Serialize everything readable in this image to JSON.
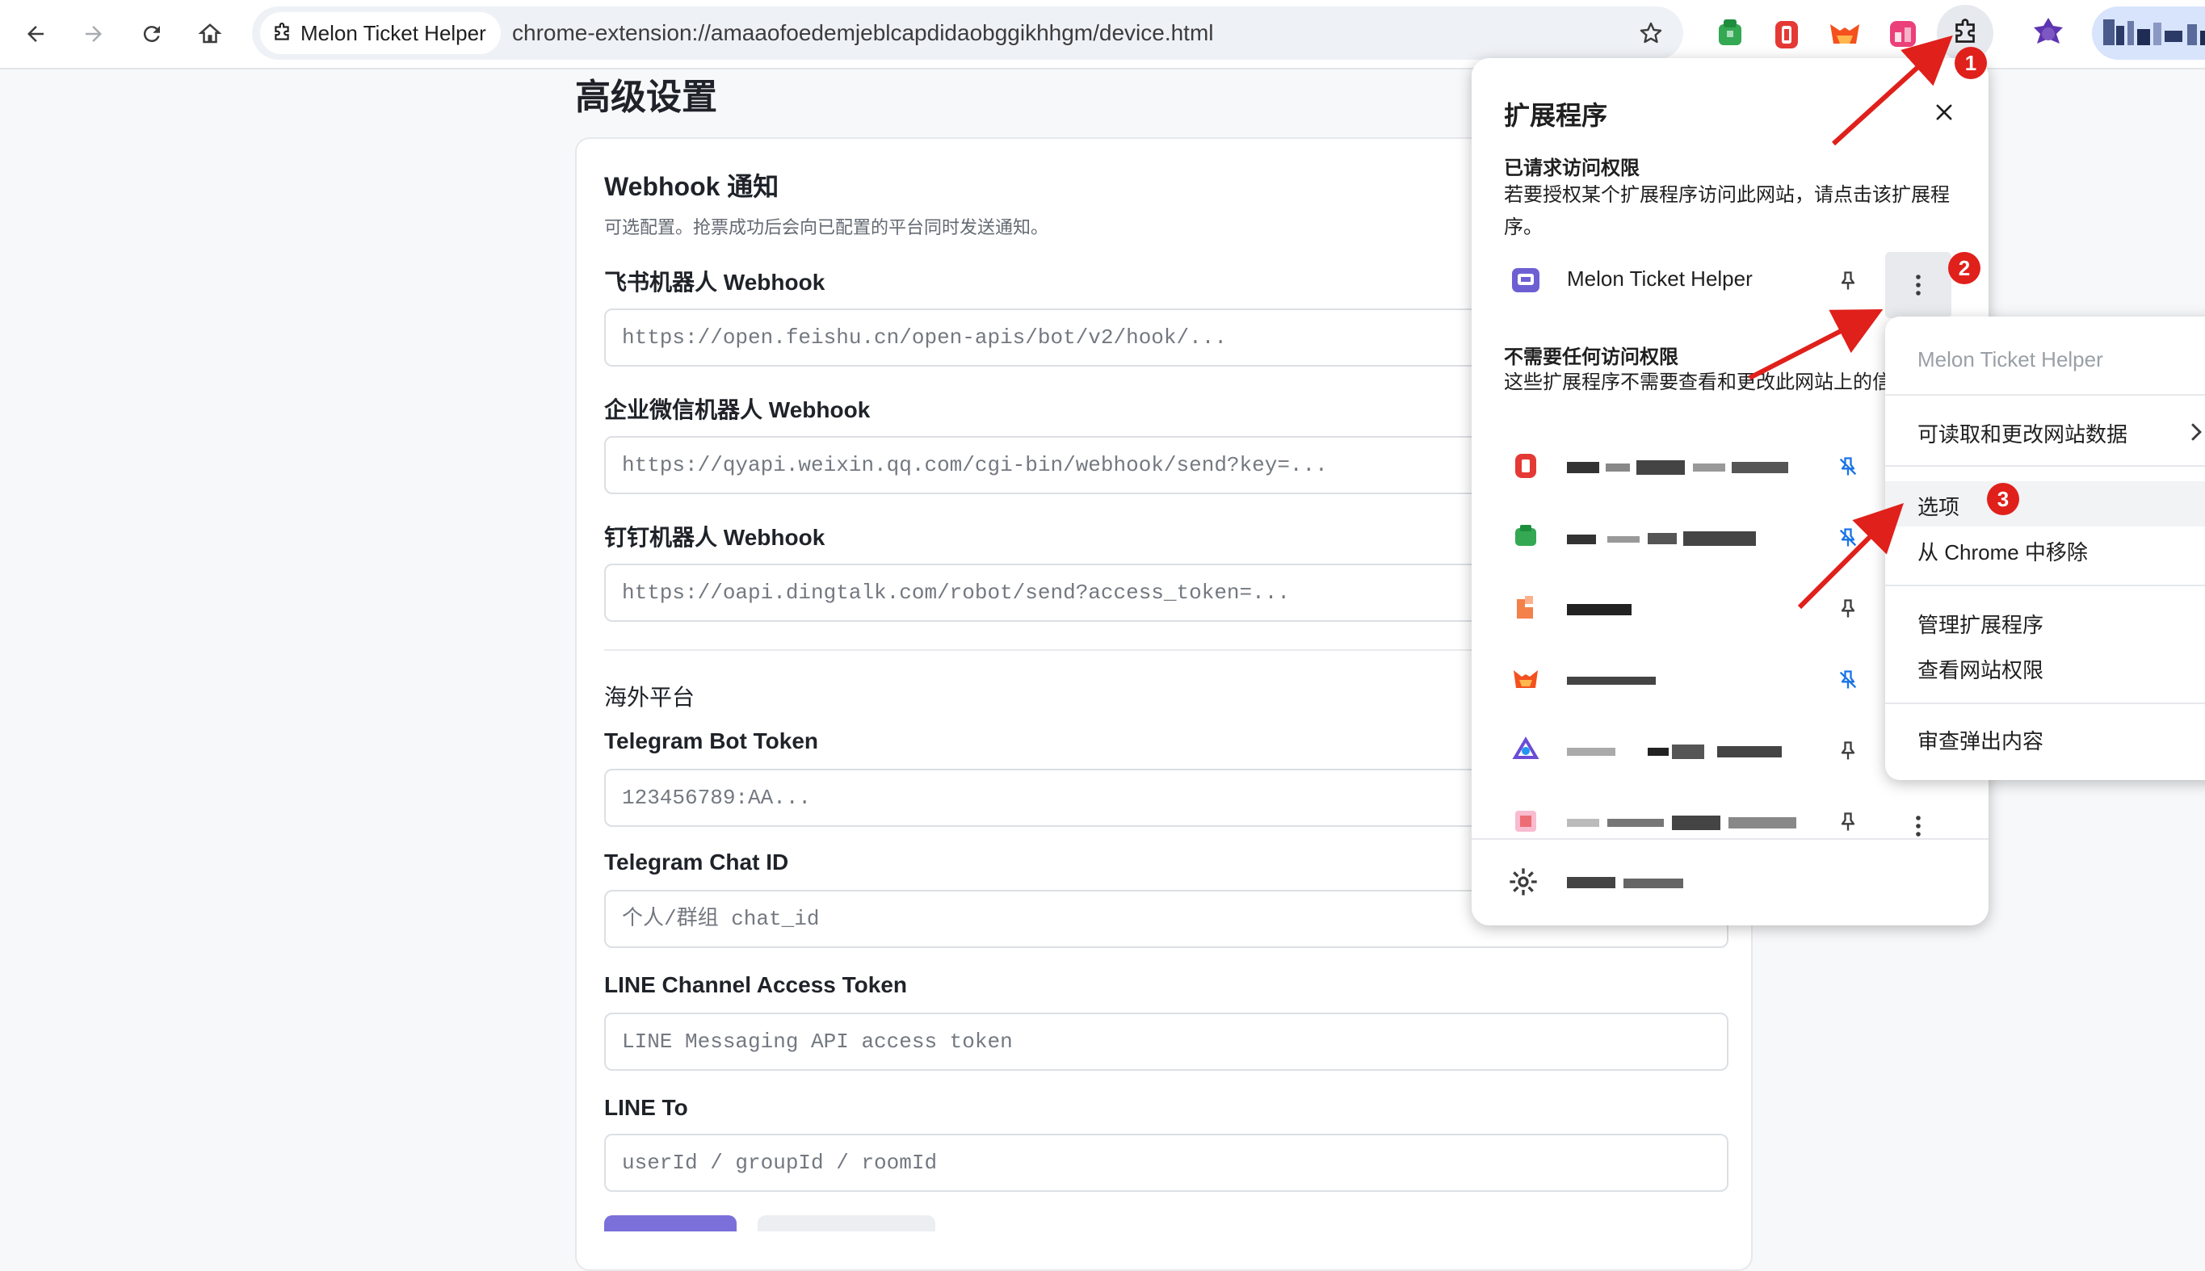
{
  "browser": {
    "tab_chip_label": "Melon Ticket Helper",
    "url": "chrome-extension://amaaofoedemjeblcapdidaobggikhhgm/device.html"
  },
  "page": {
    "title": "高级设置",
    "card": {
      "title": "Webhook 通知",
      "description": "可选配置。抢票成功后会向已配置的平台同时发送通知。",
      "fields": [
        {
          "label": "飞书机器人 Webhook",
          "placeholder": "https://open.feishu.cn/open-apis/bot/v2/hook/..."
        },
        {
          "label": "企业微信机器人 Webhook",
          "placeholder": "https://qyapi.weixin.qq.com/cgi-bin/webhook/send?key=..."
        },
        {
          "label": "钉钉机器人 Webhook",
          "placeholder": "https://oapi.dingtalk.com/robot/send?access_token=..."
        }
      ],
      "overseas_section": "海外平台",
      "overseas_fields": [
        {
          "label": "Telegram Bot Token",
          "placeholder": "123456789:AA..."
        },
        {
          "label": "Telegram Chat ID",
          "placeholder": "个人/群组 chat_id"
        },
        {
          "label": "LINE Channel Access Token",
          "placeholder": "LINE Messaging API access token"
        },
        {
          "label": "LINE To",
          "placeholder": "userId / groupId / roomId"
        }
      ]
    }
  },
  "extensions_popup": {
    "title": "扩展程序",
    "requested_heading": "已请求访问权限",
    "requested_desc": "若要授权某个扩展程序访问此网站，请点击该扩展程序。",
    "requested_item": "Melon Ticket Helper",
    "no_access_heading": "不需要任何访问权限",
    "no_access_desc": "这些扩展程序不需要查看和更改此网站上的信息。"
  },
  "context_menu": {
    "header": "Melon Ticket Helper",
    "read_change": "可读取和更改网站数据",
    "options": "选项",
    "remove": "从 Chrome 中移除",
    "manage": "管理扩展程序",
    "site_permissions": "查看网站权限",
    "inspect_popup": "审查弹出内容"
  },
  "annotations": {
    "badge_1": "1",
    "badge_2": "2",
    "badge_3": "3"
  },
  "colors": {
    "annotation_red": "#e0201b",
    "accent_purple": "#7b70d9",
    "pin_blue": "#1a73e8"
  }
}
